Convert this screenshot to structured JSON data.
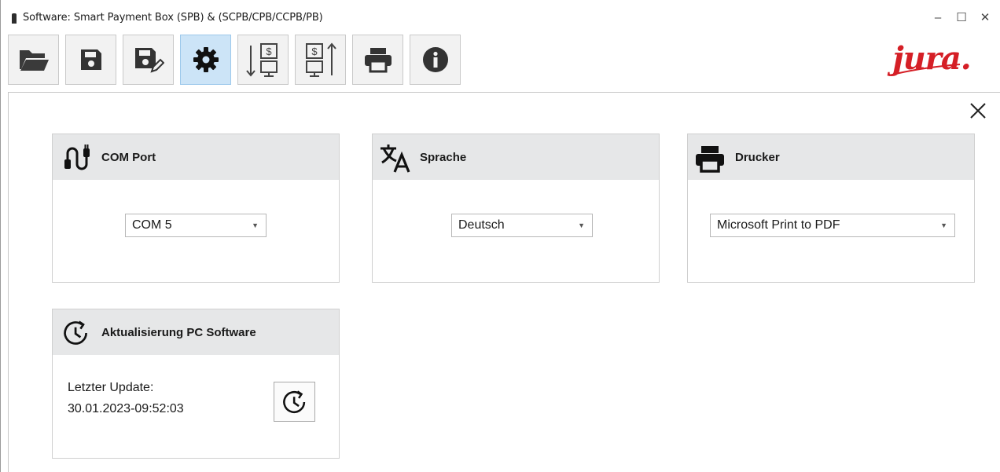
{
  "window": {
    "title": "Software: Smart Payment Box (SPB) & (SCPB/CPB/CCPB/PB)",
    "controls": {
      "minimize": "–",
      "maximize": "☐",
      "close": "✕"
    }
  },
  "toolbar": {
    "buttons": [
      {
        "icon": "folder-open-icon",
        "active": false
      },
      {
        "icon": "save-icon",
        "active": false
      },
      {
        "icon": "save-as-icon",
        "active": false
      },
      {
        "icon": "gear-icon",
        "active": true
      },
      {
        "icon": "download-price-icon",
        "active": false
      },
      {
        "icon": "upload-price-icon",
        "active": false
      },
      {
        "icon": "printer-icon",
        "active": false
      },
      {
        "icon": "info-icon",
        "active": false
      }
    ],
    "active_color": "#cce4f7"
  },
  "brand": {
    "logo_text": "jura",
    "logo_color": "#d51f26"
  },
  "panels": {
    "com_port": {
      "title": "COM Port",
      "selected": "COM  5"
    },
    "language": {
      "title": "Sprache",
      "selected": "Deutsch"
    },
    "printer": {
      "title": "Drucker",
      "selected": "Microsoft Print to PDF"
    },
    "update": {
      "title": "Aktualisierung PC Software",
      "last_update_label": "Letzter Update:",
      "last_update_value": "30.01.2023-09:52:03"
    }
  },
  "colors": {
    "panel_header": "#e6e7e8",
    "icon": "#111111"
  }
}
